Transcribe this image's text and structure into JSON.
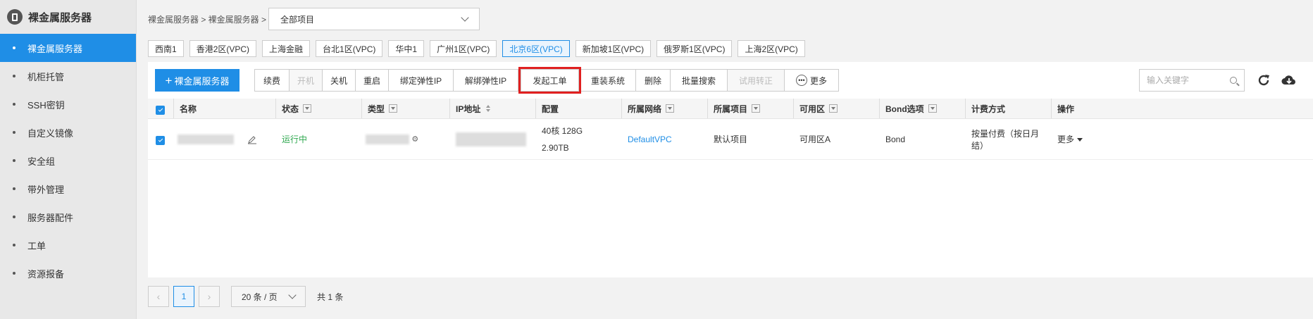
{
  "sidebar": {
    "title": "裸金属服务器",
    "items": [
      {
        "label": "裸金属服务器",
        "active": true
      },
      {
        "label": "机柜托管"
      },
      {
        "label": "SSH密钥"
      },
      {
        "label": "自定义镜像"
      },
      {
        "label": "安全组"
      },
      {
        "label": "带外管理"
      },
      {
        "label": "服务器配件"
      },
      {
        "label": "工单"
      },
      {
        "label": "资源报备"
      }
    ]
  },
  "header": {
    "breadcrumb": "裸金属服务器 > 裸金属服务器 >",
    "project_select": "全部项目"
  },
  "regions": [
    "西南1",
    "香港2区(VPC)",
    "上海金融",
    "台北1区(VPC)",
    "华中1",
    "广州1区(VPC)",
    "北京6区(VPC)",
    "新加坡1区(VPC)",
    "俄罗斯1区(VPC)",
    "上海2区(VPC)"
  ],
  "active_region": "北京6区(VPC)",
  "toolbar": {
    "create_label": "裸金属服务器",
    "actions": [
      "续费",
      "开机",
      "关机",
      "重启",
      "绑定弹性IP",
      "解绑弹性IP",
      "发起工单",
      "重装系统",
      "删除",
      "批量搜索",
      "试用转正",
      "更多"
    ],
    "search_placeholder": "输入关键字"
  },
  "table": {
    "columns": [
      "名称",
      "状态",
      "类型",
      "IP地址",
      "配置",
      "所属网络",
      "所属项目",
      "可用区",
      "Bond选项",
      "计费方式",
      "操作"
    ],
    "rows": [
      {
        "status": "运行中",
        "config_line1": "40核 128G",
        "config_line2": "2.90TB",
        "network": "DefaultVPC",
        "project": "默认项目",
        "zone": "可用区A",
        "bond": "Bond",
        "billing": "按量付费（按日月结）",
        "action": "更多"
      }
    ]
  },
  "pagination": {
    "current_page": "1",
    "page_size": "20 条 / 页",
    "total": "共 1 条"
  },
  "colors": {
    "accent": "#1f8ee6",
    "running": "#2fa84f",
    "highlight": "#e02020"
  }
}
